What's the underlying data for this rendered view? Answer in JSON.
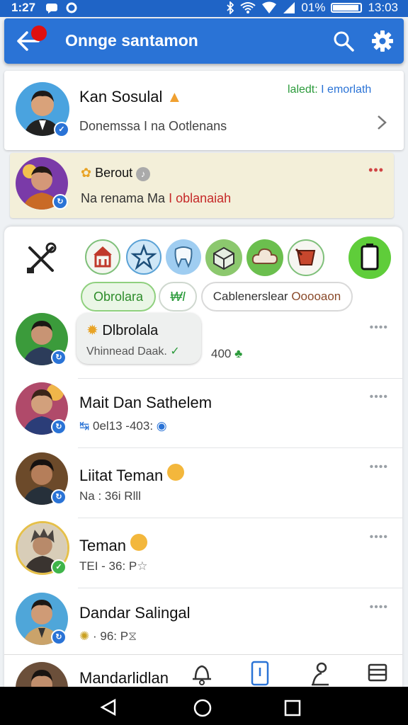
{
  "status_bar": {
    "time": "1:27",
    "battery": "01%",
    "battery_level": 0.9,
    "clock": "13:03"
  },
  "app_bar": {
    "title": "Onnge santamon",
    "back_icon": "arrow-left-icon",
    "search_icon": "search-icon",
    "settings_icon": "gear-icon",
    "accent": "#2a73d6"
  },
  "profile": {
    "name": "Kan Sosulal",
    "subtitle": "Donemssa I na Ootlenans",
    "link_prefix": "laledt:",
    "link_text": "I emorlath"
  },
  "pinned": {
    "name": "Berout",
    "subtitle_prefix": "Na renama Ma",
    "subtitle_highlight": "I oblanaiah",
    "more": "•••"
  },
  "chips": [
    {
      "label": "Obrolara"
    },
    {
      "label": "₩I"
    },
    {
      "label": "Cablenerslear",
      "extra": "Ooooaon"
    }
  ],
  "chats": [
    {
      "name": "Dlbrolala",
      "sub": "Vhinnead Daak.",
      "extra": "400",
      "more": "••••"
    },
    {
      "name": "Mait Dan Sathelem",
      "sub": "0el13 -403:",
      "more": "••••"
    },
    {
      "name": "Liitat Teman",
      "sub": "Na : 36i Rlll",
      "more": "••••"
    },
    {
      "name": "Teman",
      "sub": "TEI - 36: P",
      "more": "••••"
    },
    {
      "name": "Dandar Salingal",
      "sub": "· 96: P",
      "more": "••••"
    },
    {
      "name": "Mandarlidlan"
    }
  ],
  "colors": {
    "app_bar": "#2a73d6",
    "status_bar": "#1f64c6",
    "pinned_bg": "#f3efd9",
    "green": "#3fb54a"
  }
}
